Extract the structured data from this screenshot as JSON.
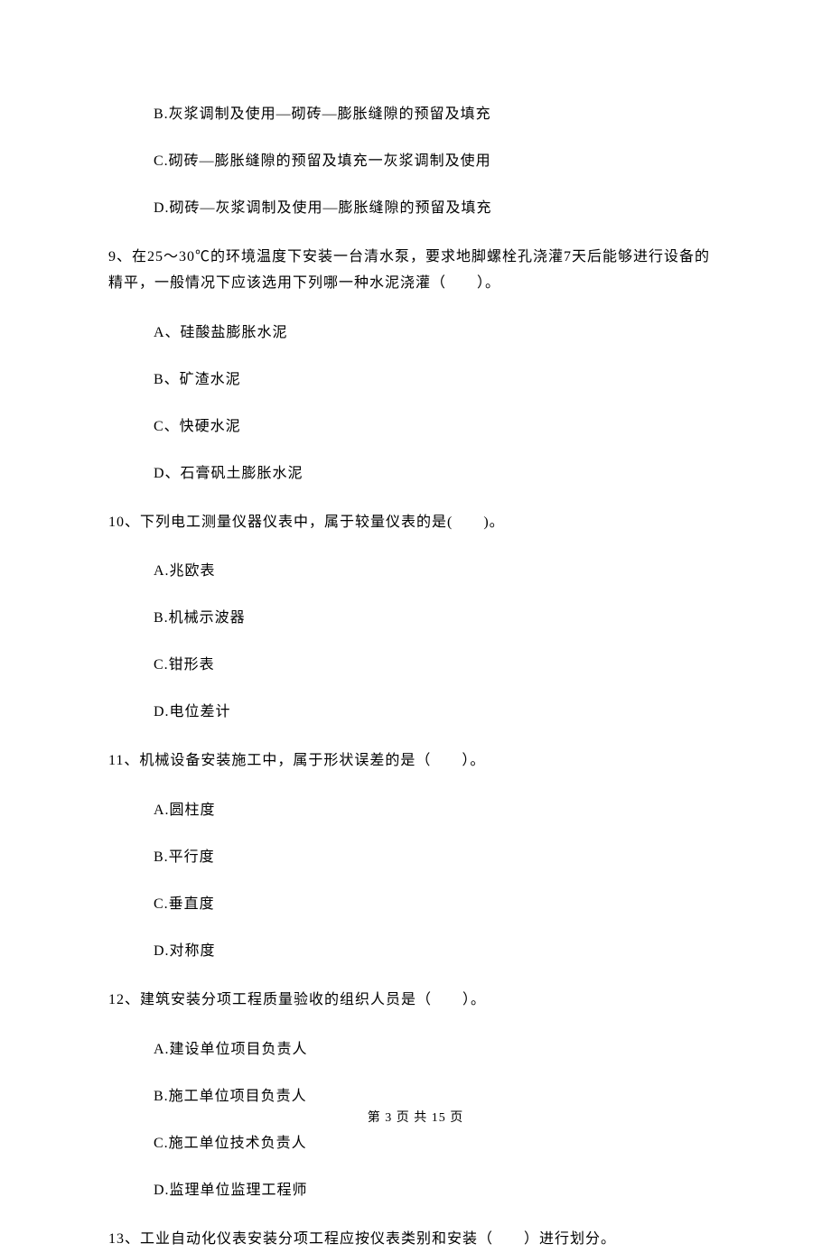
{
  "topOptions": {
    "b": "B.灰浆调制及使用—砌砖—膨胀缝隙的预留及填充",
    "c": "C.砌砖—膨胀缝隙的预留及填充一灰浆调制及使用",
    "d": "D.砌砖—灰浆调制及使用—膨胀缝隙的预留及填充"
  },
  "q9": {
    "text": "9、在25～30℃的环境温度下安装一台清水泵，要求地脚螺栓孔浇灌7天后能够进行设备的精平，一般情况下应该选用下列哪一种水泥浇灌（　　）。",
    "a": "A、硅酸盐膨胀水泥",
    "b": "B、矿渣水泥",
    "c": "C、快硬水泥",
    "d": "D、石膏矾土膨胀水泥"
  },
  "q10": {
    "text": "10、下列电工测量仪器仪表中，属于较量仪表的是(　　)。",
    "a": "A.兆欧表",
    "b": "B.机械示波器",
    "c": "C.钳形表",
    "d": "D.电位差计"
  },
  "q11": {
    "text": "11、机械设备安装施工中，属于形状误差的是（　　）。",
    "a": "A.圆柱度",
    "b": "B.平行度",
    "c": "C.垂直度",
    "d": "D.对称度"
  },
  "q12": {
    "text": "12、建筑安装分项工程质量验收的组织人员是（　　）。",
    "a": "A.建设单位项目负责人",
    "b": "B.施工单位项目负责人",
    "c": "C.施工单位技术负责人",
    "d": "D.监理单位监理工程师"
  },
  "q13": {
    "text": "13、工业自动化仪表安装分项工程应按仪表类别和安装（　　）进行划分。"
  },
  "footer": "第 3 页 共 15 页"
}
